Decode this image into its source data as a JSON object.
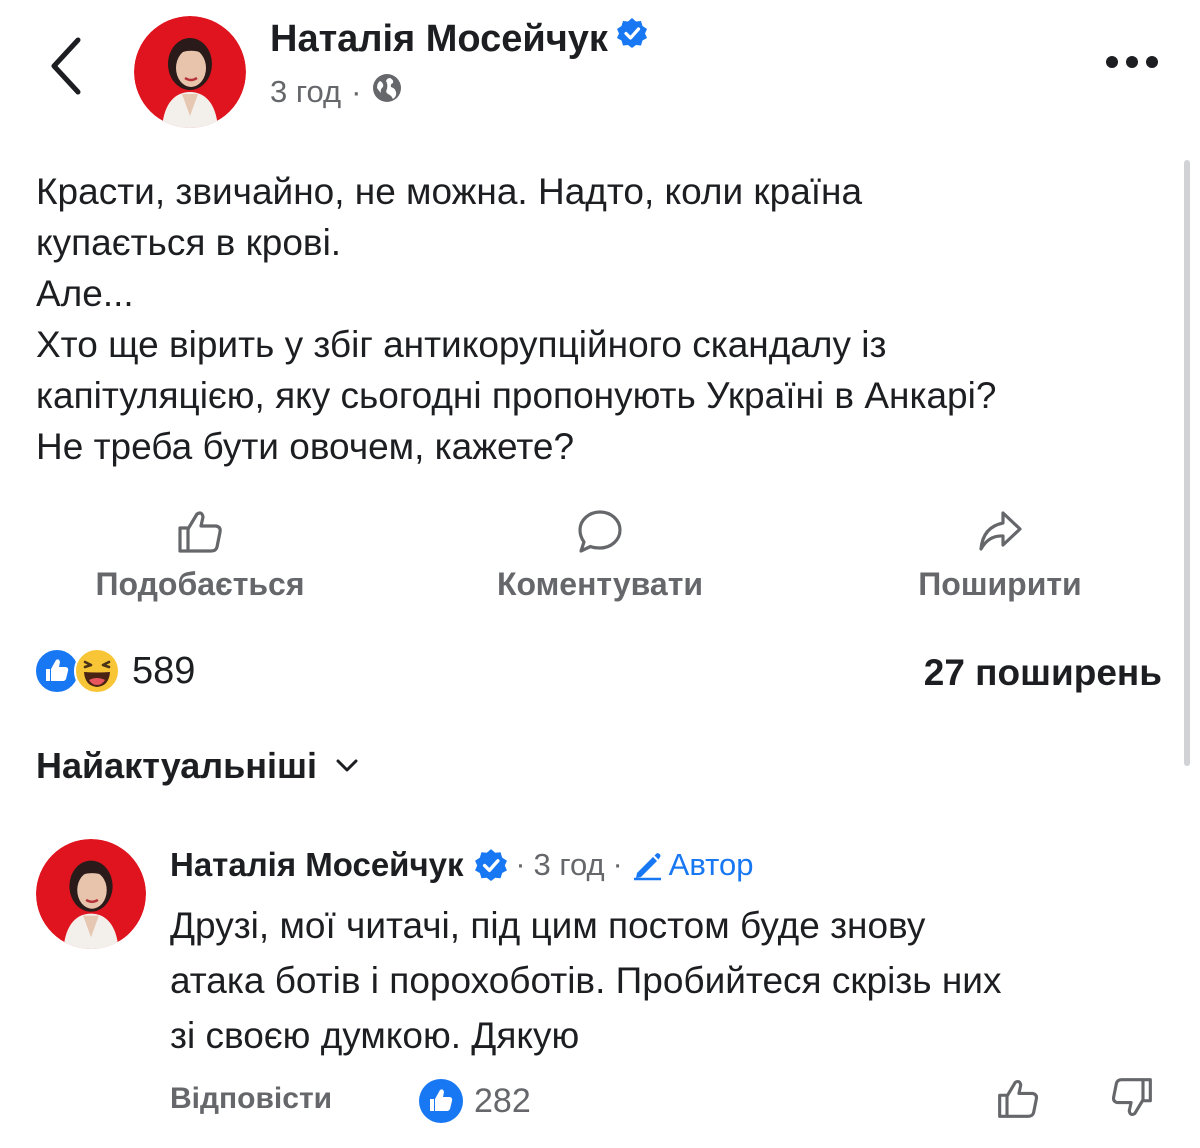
{
  "post": {
    "author": "Наталія Мосейчук",
    "time": "3 год",
    "meta_separator": "·",
    "text_lines": [
      "Красти, звичайно, не можна. Надто, коли країна",
      "купається в крові.",
      "Але...",
      "Хто ще вірить у збіг антикорупційного скандалу із",
      "капітуляцією, яку сьогодні пропонують Україні в Анкарі?",
      "Не треба бути овочем, кажете?"
    ]
  },
  "actions": {
    "like": "Подобається",
    "comment": "Коментувати",
    "share": "Поширити"
  },
  "stats": {
    "reactions_count": "589",
    "shares": "27 поширень"
  },
  "sort": {
    "label": "Найактуальніші"
  },
  "comment": {
    "author": "Наталія Мосейчук",
    "separator": "·",
    "time": "3 год",
    "author_badge": "Автор",
    "text_lines": [
      "Друзі, мої читачі, під цим постом буде знову",
      "атака ботів і порохоботів. Пробийтеся скрізь них",
      "зі своєю думкою. Дякую"
    ],
    "reply_label": "Відповісти",
    "likes": "282"
  },
  "colors": {
    "accent": "#1877f2",
    "text": "#1c1e21",
    "secondary": "#65676b",
    "avatar_bg": "#e0141e"
  },
  "icons": [
    "back-icon",
    "verified-icon",
    "globe-icon",
    "more-icon",
    "like-icon",
    "comment-icon",
    "share-icon",
    "like-reaction-icon",
    "haha-reaction-icon",
    "chevron-down-icon",
    "edit-icon",
    "dislike-icon"
  ]
}
